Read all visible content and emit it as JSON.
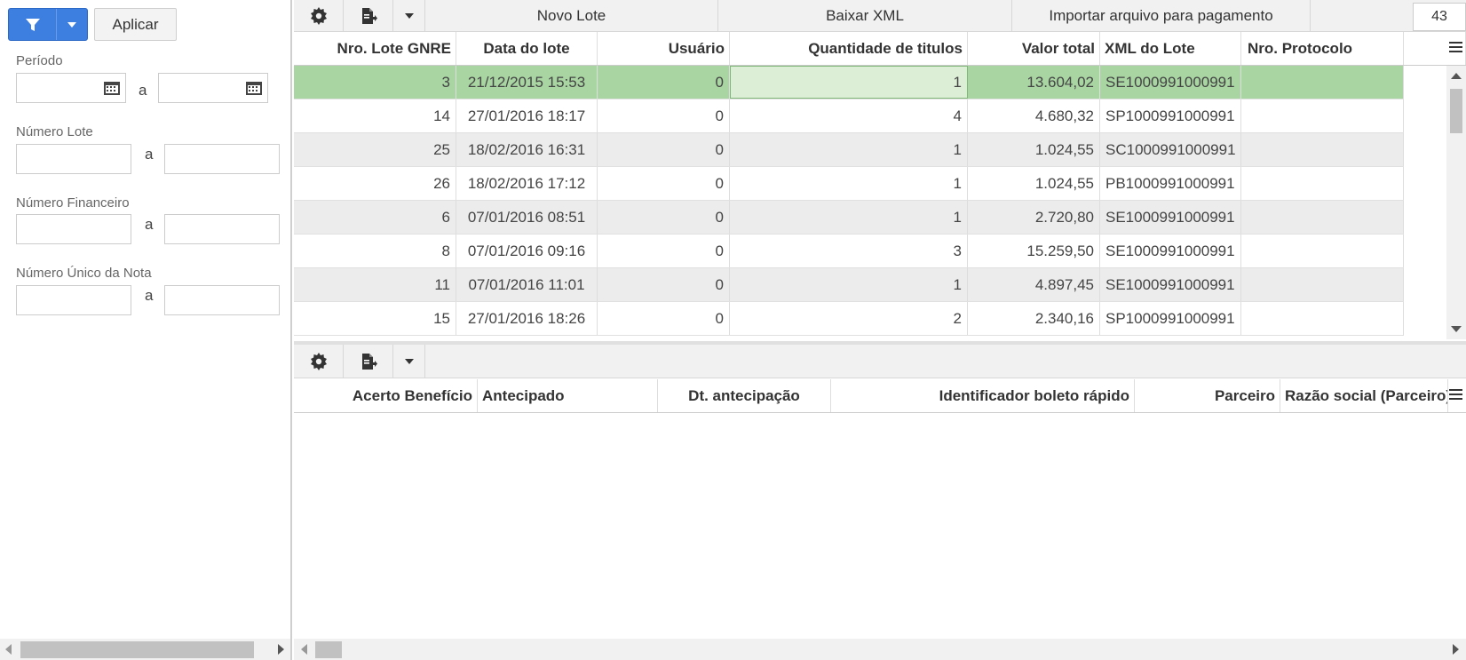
{
  "filter_panel": {
    "apply_label": "Aplicar",
    "periodo_label": "Período",
    "numero_lote_label": "Número Lote",
    "numero_financeiro_label": "Número Financeiro",
    "numero_unico_label": "Número Único da Nota",
    "range_sep": "a"
  },
  "top_toolbar": {
    "novo_lote": "Novo Lote",
    "baixar_xml": "Baixar XML",
    "importar": "Importar arquivo para pagamento",
    "count": "43"
  },
  "top_grid": {
    "columns": [
      "Nro. Lote GNRE",
      "Data do lote",
      "Usuário",
      "Quantidade de titulos",
      "Valor total",
      "XML do Lote",
      "Nro. Protocolo"
    ],
    "rows": [
      [
        "3",
        "21/12/2015 15:53",
        "0",
        "1",
        "13.604,02",
        "SE1000991000991",
        ""
      ],
      [
        "14",
        "27/01/2016 18:17",
        "0",
        "4",
        "4.680,32",
        "SP1000991000991",
        ""
      ],
      [
        "25",
        "18/02/2016 16:31",
        "0",
        "1",
        "1.024,55",
        "SC1000991000991",
        ""
      ],
      [
        "26",
        "18/02/2016 17:12",
        "0",
        "1",
        "1.024,55",
        "PB1000991000991",
        ""
      ],
      [
        "6",
        "07/01/2016 08:51",
        "0",
        "1",
        "2.720,80",
        "SE1000991000991",
        ""
      ],
      [
        "8",
        "07/01/2016 09:16",
        "0",
        "3",
        "15.259,50",
        "SE1000991000991",
        ""
      ],
      [
        "11",
        "07/01/2016 11:01",
        "0",
        "1",
        "4.897,45",
        "SE1000991000991",
        ""
      ],
      [
        "15",
        "27/01/2016 18:26",
        "0",
        "2",
        "2.340,16",
        "SP1000991000991",
        ""
      ]
    ]
  },
  "bottom_grid": {
    "columns": [
      "Acerto Benefício",
      "Antecipado",
      "Dt. antecipação",
      "Identificador boleto rápido",
      "Parceiro",
      "Razão social (Parceiro)"
    ]
  },
  "colors": {
    "accent": "#3d7fe0",
    "selected_row": "#a8d5a2",
    "focused_cell": "#ddeed7"
  }
}
